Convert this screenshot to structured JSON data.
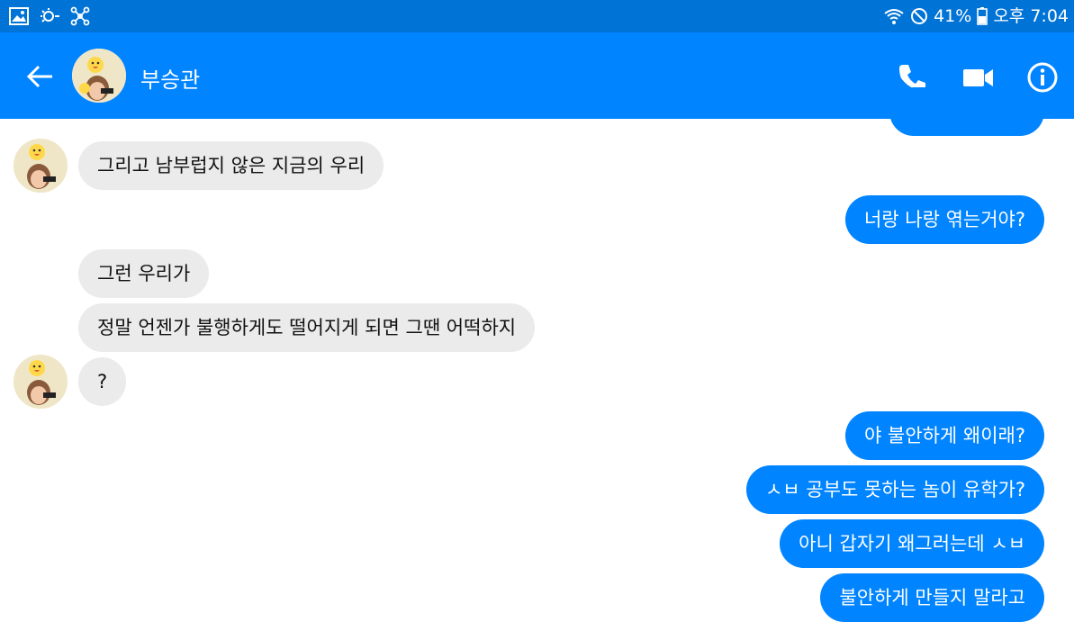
{
  "status_bar": {
    "battery": "41%",
    "time": "오후 7:04"
  },
  "header": {
    "contact_name": "부승관"
  },
  "messages": [
    {
      "side": "in",
      "text": "그리고 남부럽지 않은 지금의 우리"
    },
    {
      "side": "out",
      "text": "너랑 나랑 엮는거야?"
    },
    {
      "side": "in",
      "text": "그런 우리가"
    },
    {
      "side": "in",
      "text": "정말 언젠가 불행하게도 떨어지게 되면 그땐 어떡하지"
    },
    {
      "side": "in",
      "text": "?"
    },
    {
      "side": "out",
      "text": "야 불안하게 왜이래?"
    },
    {
      "side": "out",
      "text": "ㅅㅂ 공부도 못하는 놈이 유학가?"
    },
    {
      "side": "out",
      "text": "아니 갑자기 왜그러는데 ㅅㅂ"
    },
    {
      "side": "out",
      "text": "불안하게 만들지 말라고"
    }
  ],
  "colors": {
    "status_bar": "#0073d6",
    "header": "#0084ff",
    "outgoing_bubble": "#0084ff",
    "incoming_bubble": "#ebebeb"
  }
}
